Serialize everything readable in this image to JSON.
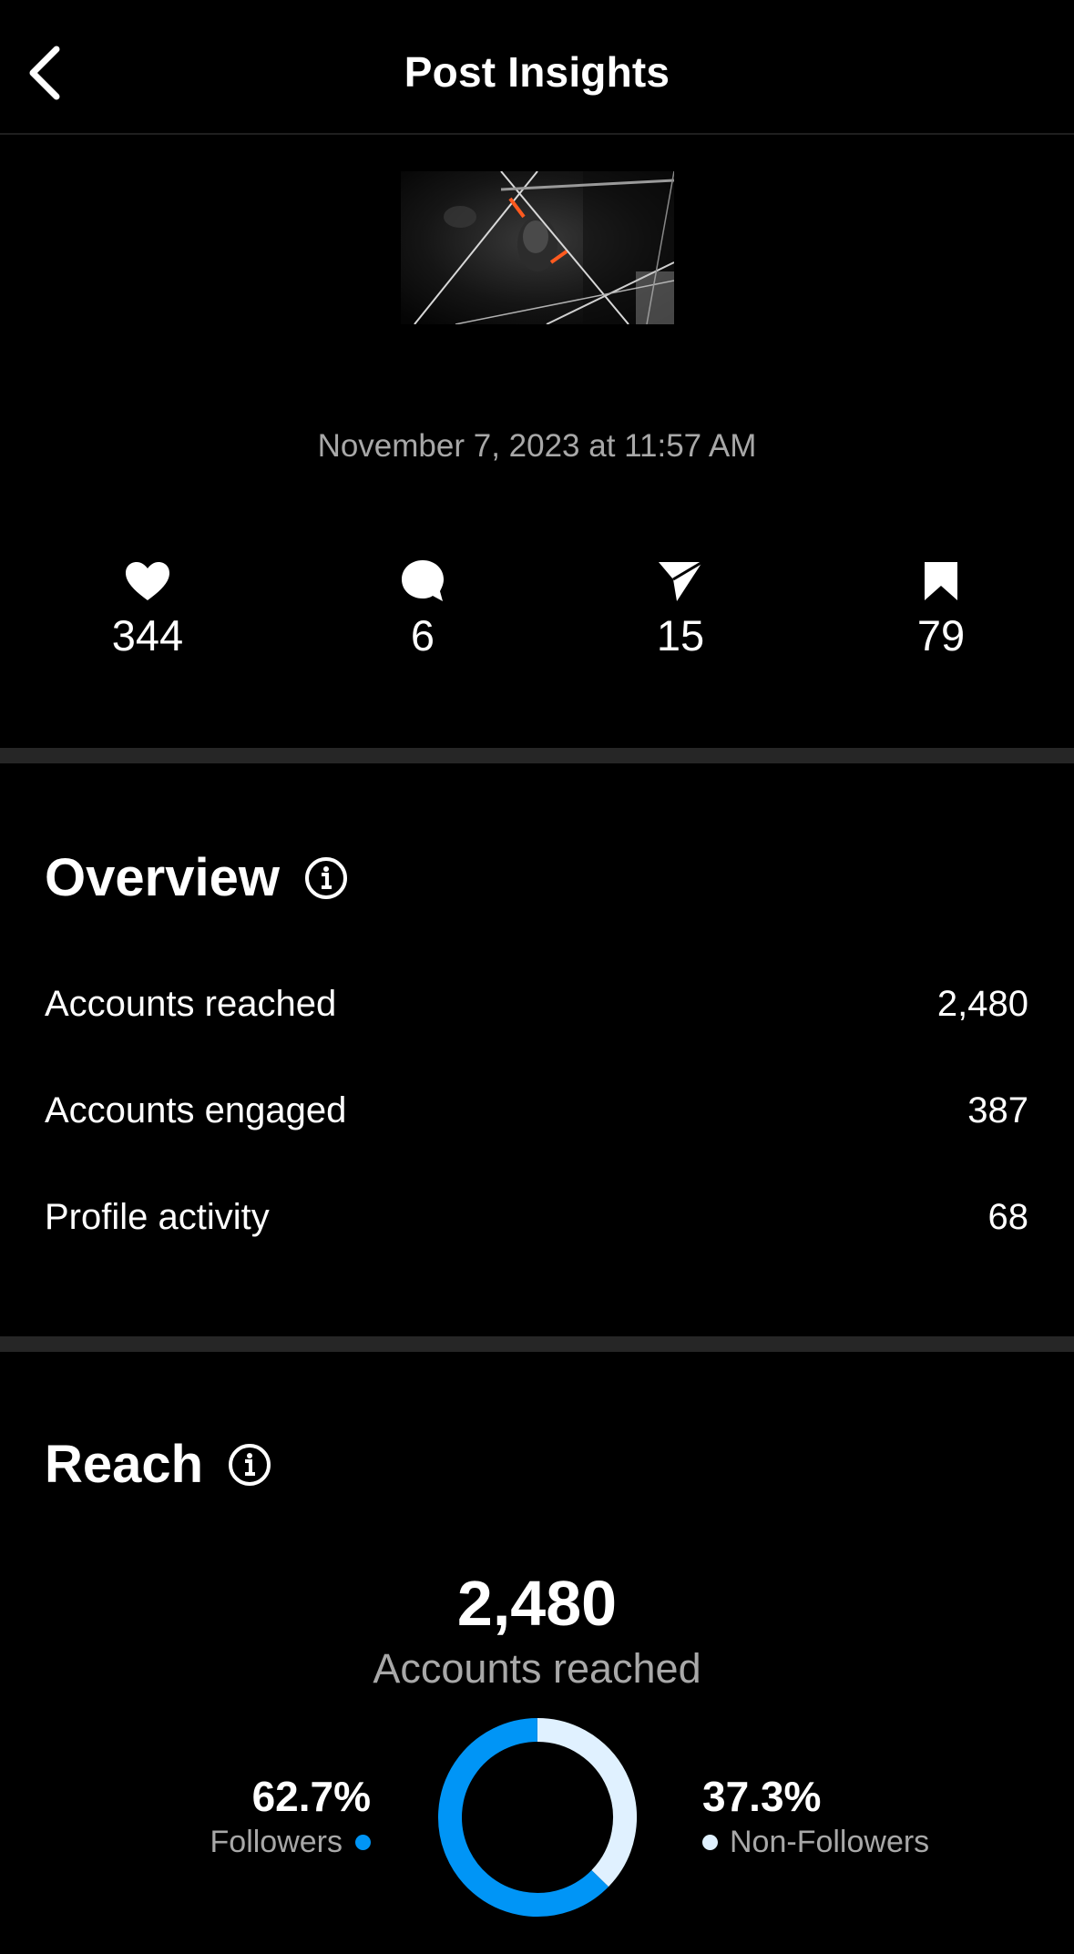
{
  "header": {
    "title": "Post Insights"
  },
  "post": {
    "date": "November 7, 2023 at 11:57 AM"
  },
  "stats": {
    "likes": "344",
    "comments": "6",
    "shares": "15",
    "saves": "79"
  },
  "overview": {
    "title": "Overview",
    "rows": [
      {
        "label": "Accounts reached",
        "value": "2,480"
      },
      {
        "label": "Accounts engaged",
        "value": "387"
      },
      {
        "label": "Profile activity",
        "value": "68"
      }
    ]
  },
  "reach": {
    "title": "Reach",
    "total": "2,480",
    "total_label": "Accounts reached",
    "followers_pct": "62.7%",
    "followers_label": "Followers",
    "non_followers_pct": "37.3%",
    "non_followers_label": "Non-Followers",
    "followers_fraction": 0.627,
    "non_followers_fraction": 0.373
  },
  "colors": {
    "followers": "#0095f6",
    "non_followers": "#e0f1ff",
    "divider": "#262626",
    "muted_text": "#a8a8a8"
  },
  "icons": {
    "back": "chevron-left-icon",
    "likes": "heart-icon",
    "comments": "comment-icon",
    "shares": "send-icon",
    "saves": "bookmark-icon",
    "info": "info-icon"
  }
}
